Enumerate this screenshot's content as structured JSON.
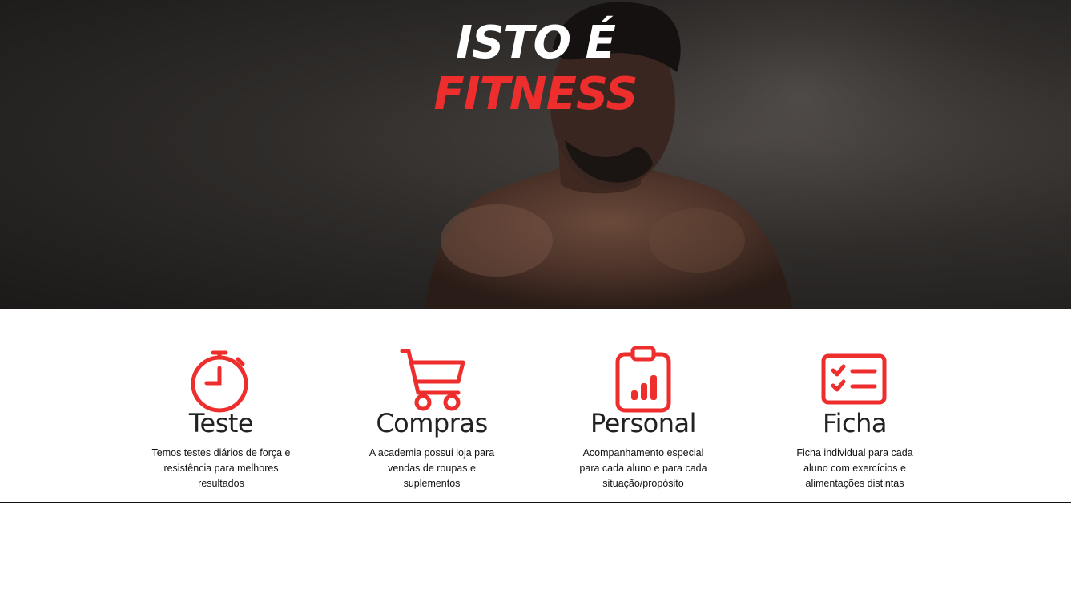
{
  "hero": {
    "title_line1": "ISTO É",
    "title_line2": "FITNESS",
    "accent_color": "#ee2d2d"
  },
  "features": [
    {
      "icon": "stopwatch-icon",
      "title": "Teste",
      "description": "Temos testes diários de força e resistência para melhores resultados"
    },
    {
      "icon": "shopping-cart-icon",
      "title": "Compras",
      "description": "A academia possui loja para vendas de roupas e suplementos"
    },
    {
      "icon": "clipboard-chart-icon",
      "title": "Personal",
      "description": "Acompanhamento especial para cada aluno e para cada situação/propósito"
    },
    {
      "icon": "checklist-icon",
      "title": "Ficha",
      "description": "Ficha individual para cada aluno com exercícios e alimentações distintas"
    }
  ]
}
